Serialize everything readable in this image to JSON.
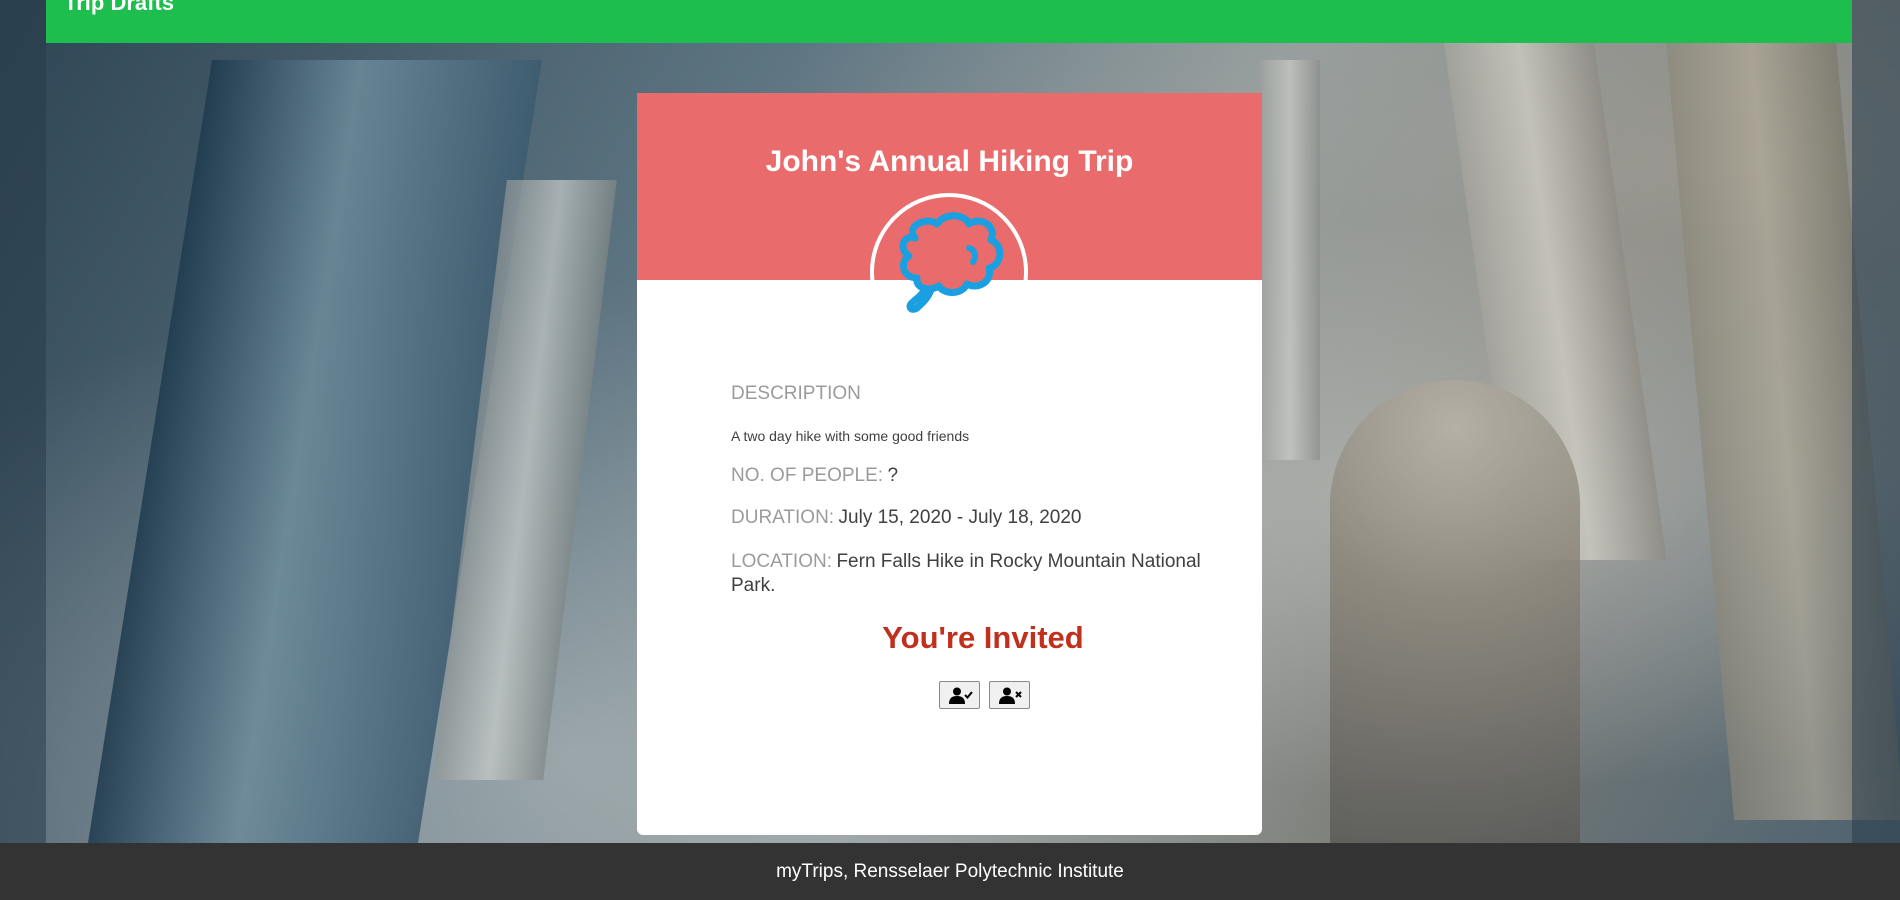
{
  "topbar": {
    "title": "Trip Drafts"
  },
  "card": {
    "title": "John's Annual Hiking Trip",
    "avatar_icon": "thought-bubble-icon",
    "description_label": "DESCRIPTION",
    "description": "A two day hike with some good friends",
    "people_label": "NO. OF PEOPLE:",
    "people_value": "?",
    "duration_label": "DURATION:",
    "duration_value": "July 15, 2020 - July 18, 2020",
    "location_label": "LOCATION:",
    "location_value": "Fern Falls Hike in Rocky Mountain National Park.",
    "invite_status": "You're Invited",
    "accept_icon": "user-check-icon",
    "decline_icon": "user-times-icon"
  },
  "footer": {
    "text": "myTrips, Rensselaer Polytechnic Institute"
  },
  "colors": {
    "topbar": "#1ebe4e",
    "card_header": "#e96b6b",
    "invited_text": "#c1301c",
    "avatar_stroke": "#1aa0e0",
    "footer": "#333333"
  }
}
